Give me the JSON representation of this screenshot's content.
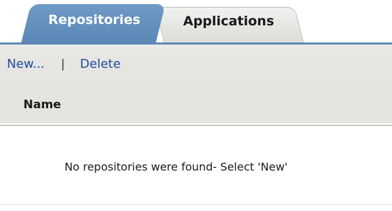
{
  "tabs": [
    {
      "label": "Repositories",
      "active": true
    },
    {
      "label": "Applications",
      "active": false
    }
  ],
  "toolbar": {
    "new_label": "New...",
    "separator": "|",
    "delete_label": "Delete"
  },
  "table": {
    "columns": [
      "Name"
    ],
    "rows": []
  },
  "empty_message": "No repositories were found- Select 'New'",
  "colors": {
    "accent": "#5b87b6",
    "link": "#1c4e9a",
    "panel": "#e6e5e2"
  }
}
